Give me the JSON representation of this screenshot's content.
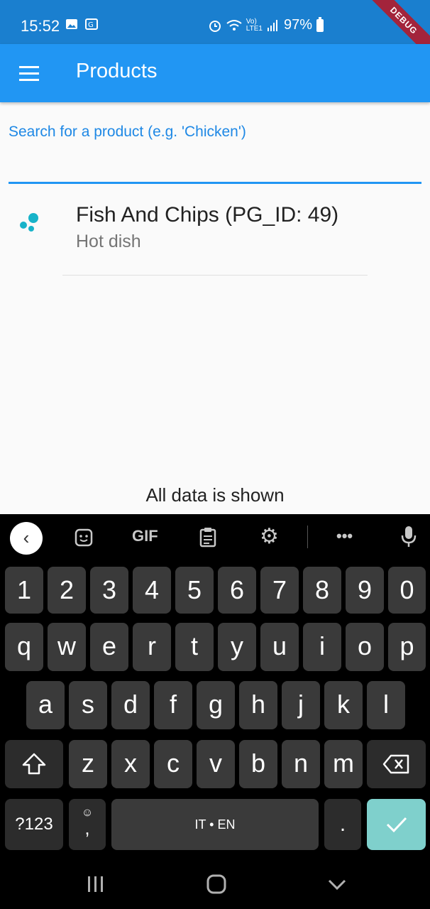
{
  "status_bar": {
    "time": "15:52",
    "battery": "97%",
    "debug_label": "DEBUG"
  },
  "app_bar": {
    "title": "Products"
  },
  "search": {
    "placeholder": "Search for a product (e.g. 'Chicken')",
    "value": ""
  },
  "products": [
    {
      "title": "Fish And Chips (PG_ID: 49)",
      "subtitle": "Hot dish"
    }
  ],
  "footer": {
    "text": "All data is shown"
  },
  "keyboard": {
    "toolbar": {
      "gif_label": "GIF",
      "more_label": "•••"
    },
    "number_row": [
      "1",
      "2",
      "3",
      "4",
      "5",
      "6",
      "7",
      "8",
      "9",
      "0"
    ],
    "row1": [
      "q",
      "w",
      "e",
      "r",
      "t",
      "y",
      "u",
      "i",
      "o",
      "p"
    ],
    "row2": [
      "a",
      "s",
      "d",
      "f",
      "g",
      "h",
      "j",
      "k",
      "l"
    ],
    "row3": [
      "z",
      "x",
      "c",
      "v",
      "b",
      "n",
      "m"
    ],
    "symbols_label": "?123",
    "comma_label": ",",
    "space_label": "IT • EN",
    "period_label": "."
  },
  "colors": {
    "app_bar": "#2196f3",
    "status_bar": "#1a7fcf",
    "accent_dots": "#17b3c9",
    "enter_key": "#7fd0cc"
  }
}
